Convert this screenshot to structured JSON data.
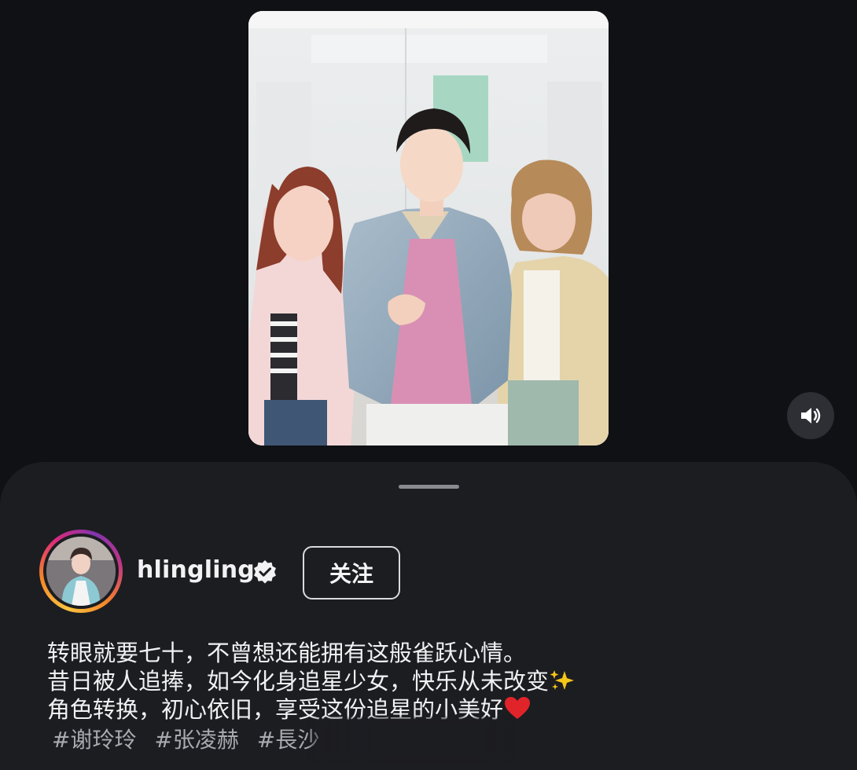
{
  "post": {
    "username": "hlingling",
    "verified": true,
    "follow_label": "关注",
    "caption_lines": [
      "转眼就要七十，不曾想还能拥有这般雀跃心情。",
      "昔日被人追捧，如今化身追星少女，快乐从未改变",
      "角色转换，初心依旧，享受这份追星的小美好"
    ],
    "hashtags": [
      "#谢玲玲",
      "#张凌赫",
      "#長沙"
    ]
  },
  "icons": {
    "mute": "speaker-icon",
    "verified": "verified-badge-icon",
    "sparkle": "sparkles-icon",
    "heart": "red-heart-icon"
  },
  "colors": {
    "background": "#101114",
    "sheet": "#1c1d21",
    "text": "#f1f1f3",
    "hashtag": "#a9aab0",
    "heart": "#e0242a",
    "sparkle": "#f5c518"
  }
}
